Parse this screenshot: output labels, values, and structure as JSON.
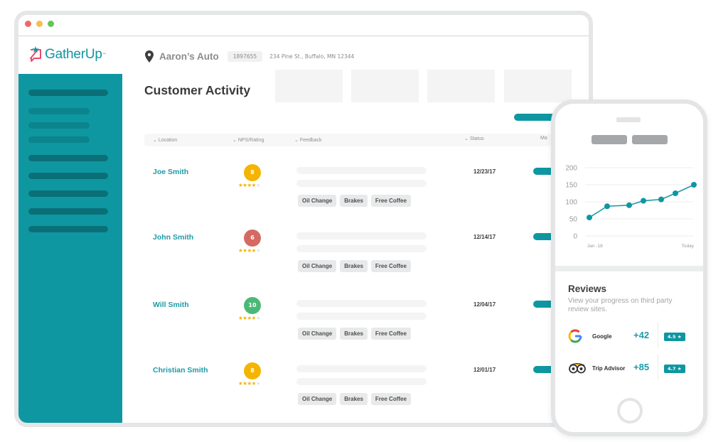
{
  "window": {
    "controls": [
      {
        "name": "close",
        "color": "#ee6a5f"
      },
      {
        "name": "minimize",
        "color": "#f5be4f"
      },
      {
        "name": "maximize",
        "color": "#62c554"
      }
    ]
  },
  "brand": {
    "name": "GatherUp",
    "tm": "™"
  },
  "location": {
    "icon": "map-pin-icon",
    "name": "Aaron’s Auto",
    "id": "1897655",
    "address": "234 Pine St., Buffalo, MN 12344"
  },
  "page": {
    "title": "Customer Activity"
  },
  "table": {
    "columns": [
      {
        "label": "Location",
        "sortable": true
      },
      {
        "label": "NPS/Rating",
        "sortable": true
      },
      {
        "label": "Feedback",
        "sortable": true
      },
      {
        "label": "Status",
        "sortable": true
      },
      {
        "label": "Ma",
        "sortable": false
      }
    ],
    "rows": [
      {
        "name": "Joe Smith",
        "nps": "8",
        "nps_color": "#f4b400",
        "rating": 4,
        "tags": [
          "Oil Change",
          "Brakes",
          "Free Coffee"
        ],
        "date": "12/23/17"
      },
      {
        "name": "John Smith",
        "nps": "6",
        "nps_color": "#d56a62",
        "rating": 4,
        "tags": [
          "Oil Change",
          "Brakes",
          "Free Coffee"
        ],
        "date": "12/14/17"
      },
      {
        "name": "Will Smith",
        "nps": "10",
        "nps_color": "#4cb877",
        "rating": 4,
        "tags": [
          "Oil Change",
          "Brakes",
          "Free Coffee"
        ],
        "date": "12/04/17"
      },
      {
        "name": "Christian Smith",
        "nps": "8",
        "nps_color": "#f4b400",
        "rating": 4,
        "tags": [
          "Oil Change",
          "Brakes",
          "Free Coffee"
        ],
        "date": "12/01/17"
      }
    ]
  },
  "colors": {
    "accent": "#0e97a1",
    "sidebar": "#0e97a1",
    "star": "#f4b400"
  },
  "phone": {
    "reviews": {
      "title": "Reviews",
      "subtitle": "View your progress on third party review sites.",
      "sites": [
        {
          "name": "Google",
          "icon": "google-icon",
          "count": "+42",
          "rating": "4.5 ★"
        },
        {
          "name": "Trip Advisor",
          "icon": "tripadvisor-icon",
          "count": "+85",
          "rating": "4.7 ★"
        }
      ]
    }
  },
  "chart_data": {
    "type": "line",
    "title": "",
    "xlabel": "",
    "ylabel": "",
    "x_labels": [
      "Jan -18",
      "Today"
    ],
    "yticks": [
      0,
      50,
      100,
      150,
      200
    ],
    "ylim": [
      0,
      200
    ],
    "grid": true,
    "series": [
      {
        "name": "Reviews",
        "values": [
          54,
          87,
          90,
          103,
          107,
          125,
          150
        ]
      }
    ]
  }
}
